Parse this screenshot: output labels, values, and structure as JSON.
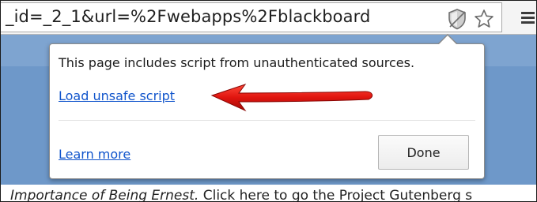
{
  "browser": {
    "url_text": "_id=_2_1&url=%2Fwebapps%2Fblackboard",
    "icons": {
      "security": "shield-icon",
      "bookmark": "star-icon",
      "menu": "hamburger-menu-icon"
    }
  },
  "security_bubble": {
    "message": "This page includes script from unauthenticated sources.",
    "load_link": "Load unsafe script",
    "learn_more_link": "Learn more",
    "done_button": "Done"
  },
  "page": {
    "text_italic": "Importance of Being Ernest.",
    "text_rest": " Click here to go the Project Gutenberg s",
    "colors": {
      "banner": "#6e98c9",
      "link": "#1155cc",
      "annotation_arrow": "#e0150f"
    }
  }
}
